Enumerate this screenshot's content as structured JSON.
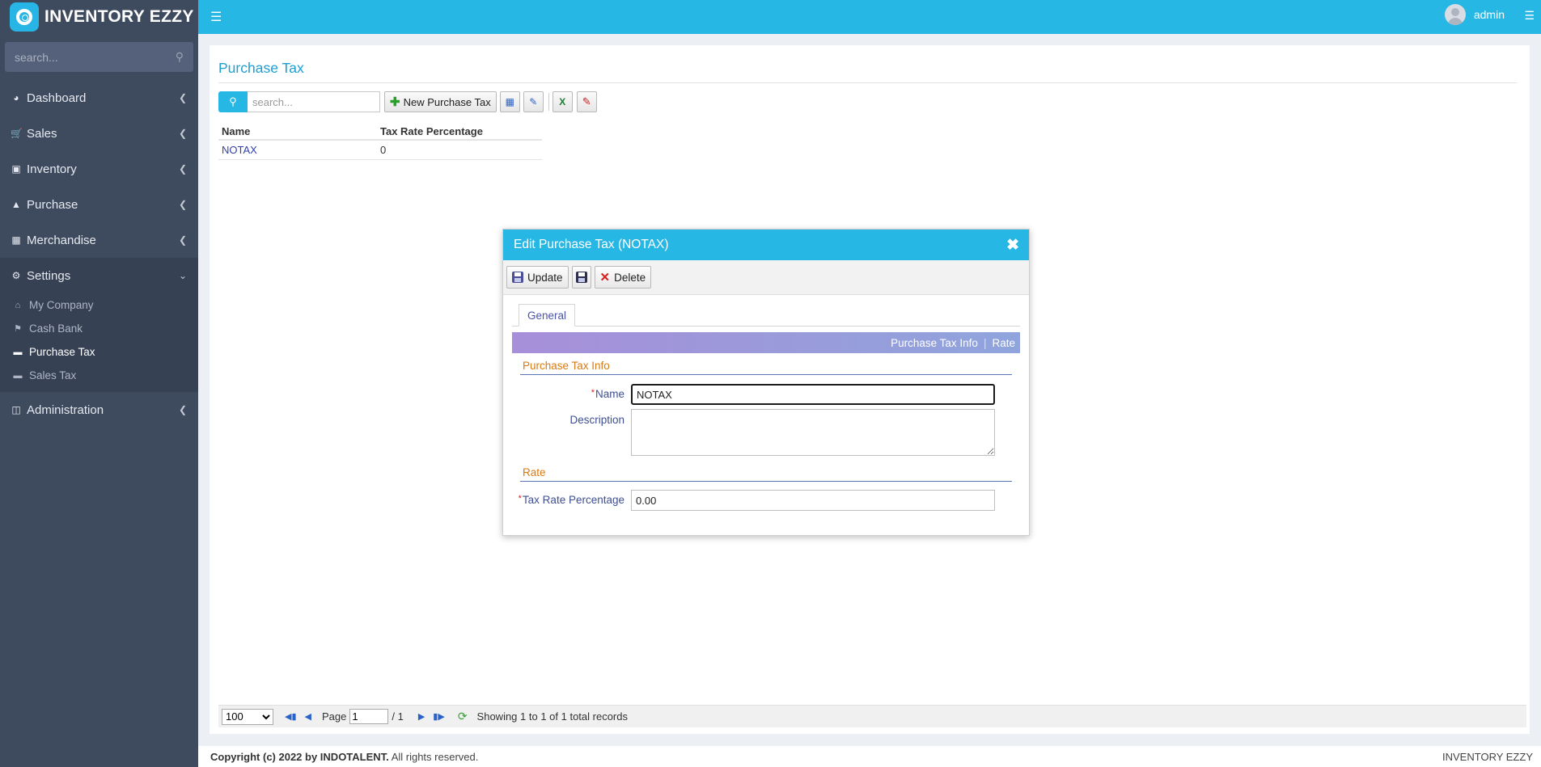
{
  "app": {
    "brand": "INVENTORY EZZY"
  },
  "sidebar": {
    "search_placeholder": "search...",
    "items": [
      {
        "label": "Dashboard",
        "icon": "tachometer-icon"
      },
      {
        "label": "Sales",
        "icon": "cart-icon"
      },
      {
        "label": "Inventory",
        "icon": "archive-icon"
      },
      {
        "label": "Purchase",
        "icon": "shopping-bag-icon"
      },
      {
        "label": "Merchandise",
        "icon": "grid-icon"
      },
      {
        "label": "Settings",
        "icon": "gear-icon",
        "expanded": true
      },
      {
        "label": "Administration",
        "icon": "desktop-icon"
      }
    ],
    "settings_sub": [
      {
        "label": "My Company",
        "icon": "home-icon"
      },
      {
        "label": "Cash Bank",
        "icon": "bank-icon"
      },
      {
        "label": "Purchase Tax",
        "icon": "folder-icon",
        "active": true
      },
      {
        "label": "Sales Tax",
        "icon": "folder-icon"
      }
    ]
  },
  "topbar": {
    "username": "admin"
  },
  "page": {
    "title": "Purchase Tax",
    "search_placeholder": "search...",
    "new_button_label": "New Purchase Tax"
  },
  "grid": {
    "columns": [
      "Name",
      "Tax Rate Percentage"
    ],
    "rows": [
      {
        "name": "NOTAX",
        "rate": "0"
      }
    ]
  },
  "pager": {
    "page_size": "100",
    "page_label": "Page",
    "page_number": "1",
    "page_total": "/ 1",
    "showing": "Showing 1 to 1 of 1 total records"
  },
  "footer": {
    "copyright_prefix": "Copyright (c) 2022 by INDOTALENT.",
    "copyright_suffix": " All rights reserved.",
    "right_text": "INVENTORY EZZY"
  },
  "dialog": {
    "title": "Edit Purchase Tax (NOTAX)",
    "update_label": "Update",
    "delete_label": "Delete",
    "tab_general": "General",
    "banner_link1": "Purchase Tax Info",
    "banner_sep": "|",
    "banner_link2": "Rate",
    "section_info": "Purchase Tax Info",
    "name_label": "Name",
    "name_value": "NOTAX",
    "description_label": "Description",
    "description_value": "",
    "section_rate": "Rate",
    "rate_label": "Tax Rate Percentage",
    "rate_value": "0.00"
  },
  "colors": {
    "accent": "#26b7e5",
    "sidebar_bg": "#3e4a5e",
    "section_title": "#d87a11",
    "link": "#3340a8"
  }
}
